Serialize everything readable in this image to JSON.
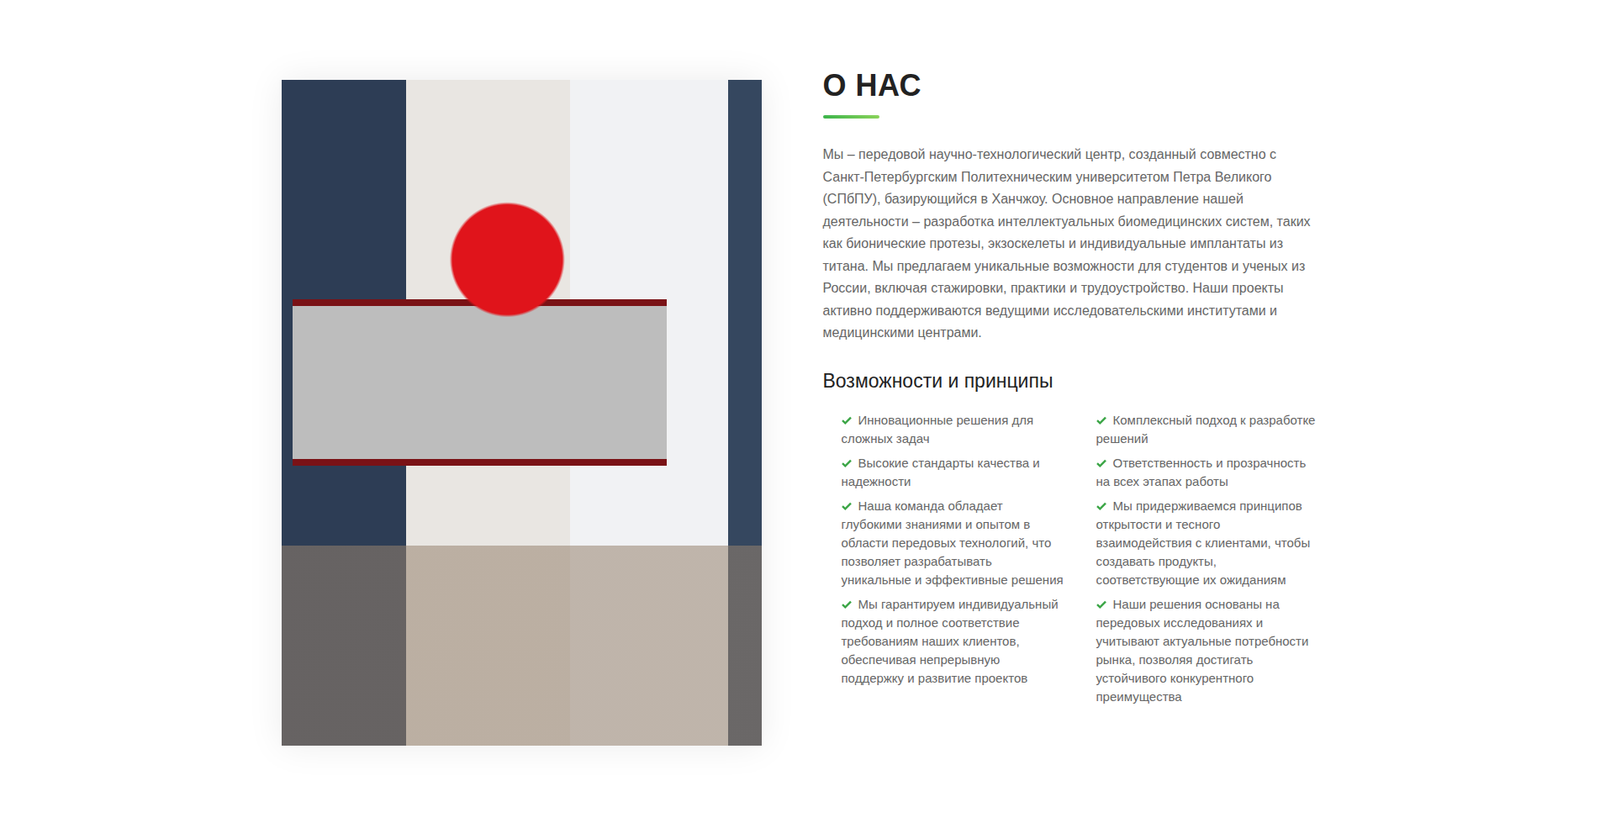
{
  "about": {
    "title": "О НАС",
    "description": "Мы – передовой научно-технологический центр, созданный совместно с Санкт-Петербургским Политехническим университетом Петра Великого (СПбПУ), базирующийся в Ханчжоу. Основное направление нашей деятельности – разработка интеллектуальных биомедицинских систем, таких как бионические протезы, экзоскелеты и индивидуальные имплантаты из титана. Мы предлагаем уникальные возможности для студентов и ученых из России, включая стажировки, практики и трудоустройство. Наши проекты активно поддерживаются ведущими исследовательскими институтами и медицинскими центрами."
  },
  "principles": {
    "title": "Возможности и принципы",
    "columns": [
      [
        "Инновационные решения для сложных задач",
        "Высокие стандарты качества и надежности",
        "Наша команда обладает глубокими знаниями и опытом в области передовых технологий, что позволяет разрабатывать уникальные и эффективные решения",
        "Мы гарантируем индивидуальный подход и полное соответствие требованиям наших клиентов, обеспечивая непрерывную поддержку и развитие проектов"
      ],
      [
        "Комплексный подход к разработке решений",
        "Ответственность и прозрачность на всех этапах работы",
        "Мы придерживаемся принципов открытости и тесного взаимодействия с клиентами, чтобы создавать продукты, соответствующие их ожиданиям",
        "Наши решения основаны на передовых исследованиях и учитывают актуальные потребности рынка, позволяя достигать устойчивого конкурентного преимущества"
      ]
    ]
  }
}
